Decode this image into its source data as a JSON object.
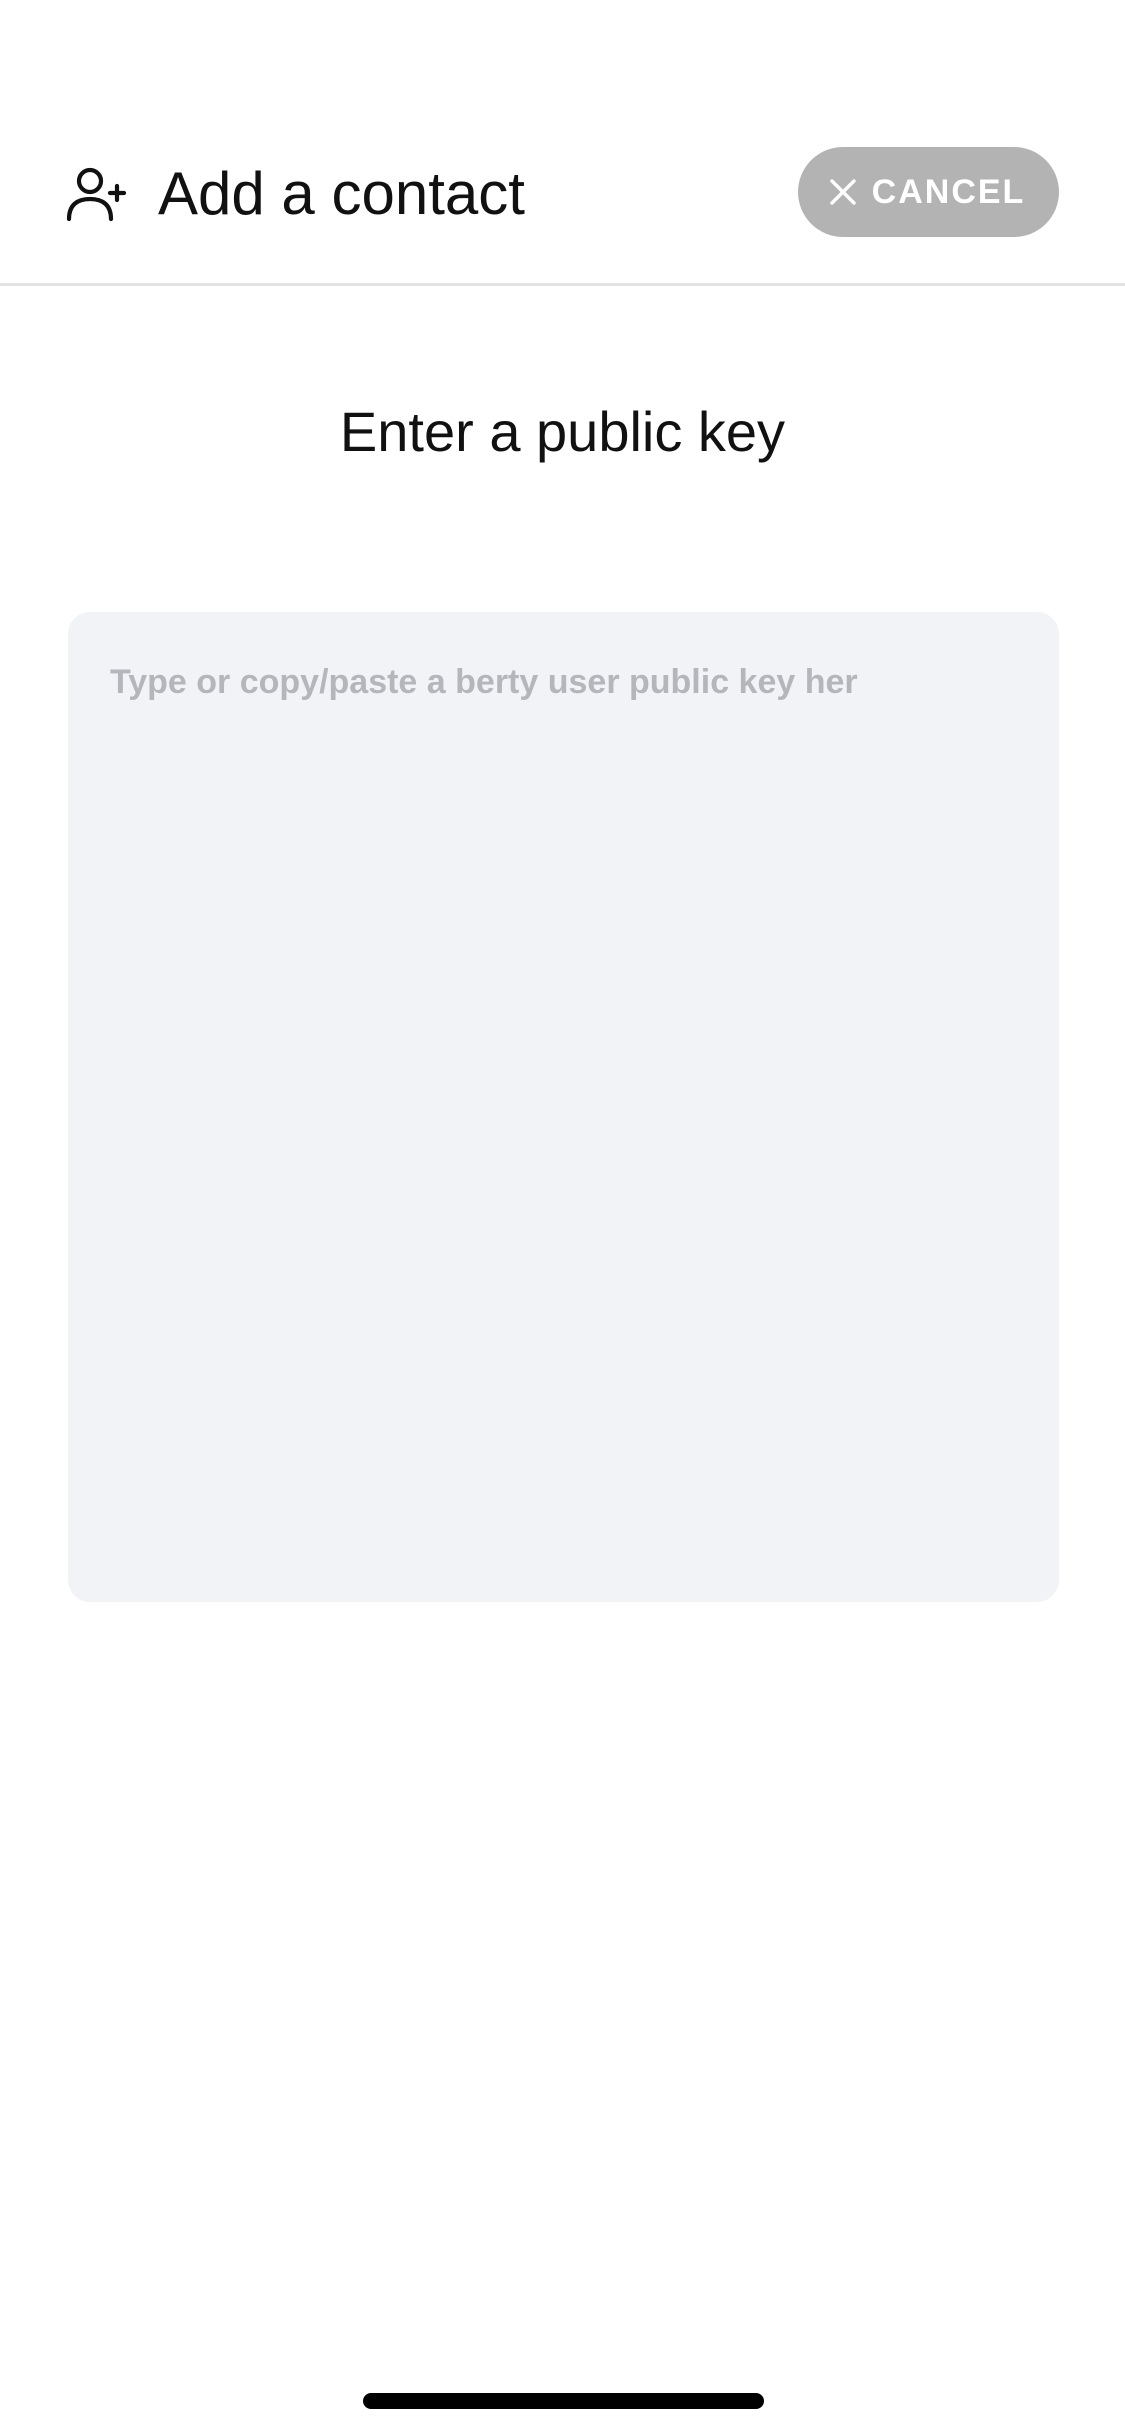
{
  "header": {
    "title": "Add a contact",
    "icon": "add-person-icon",
    "cancel_button": {
      "label": "CANCEL",
      "icon": "close-icon"
    }
  },
  "main": {
    "section_title": "Enter a public key",
    "public_key_input": {
      "value": "",
      "placeholder": "Type or copy/paste a berty user public key her"
    }
  },
  "colors": {
    "cancel_button_bg": "#b3b3b3",
    "input_bg": "#f2f3f7",
    "placeholder": "#b4b6bb",
    "divider": "#e3e3e6"
  }
}
